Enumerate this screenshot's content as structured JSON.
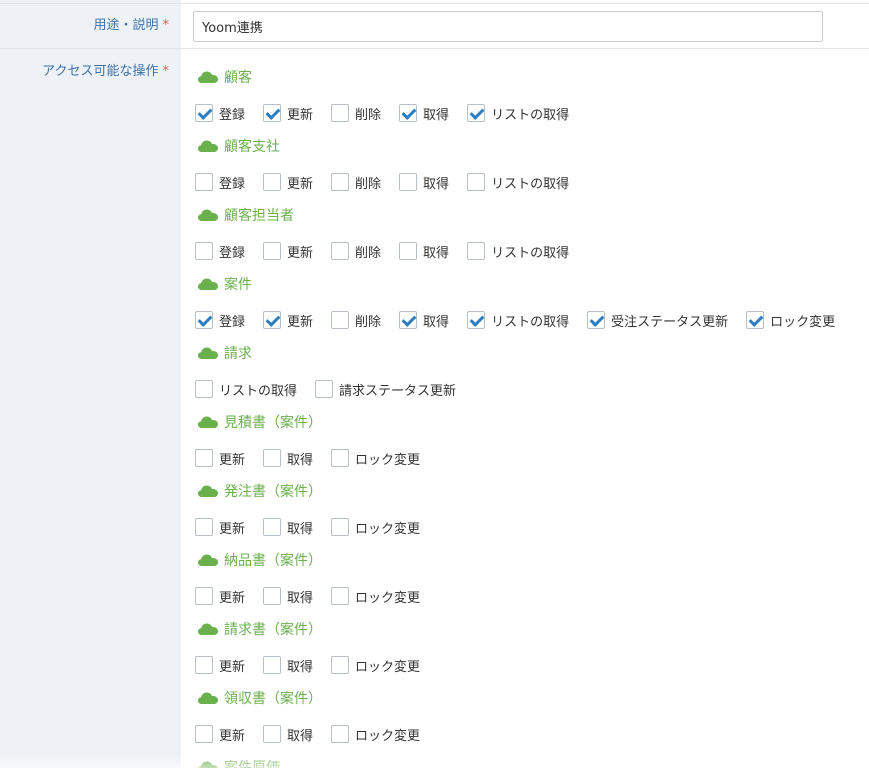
{
  "fields": {
    "purpose": {
      "label": "用途・説明",
      "required_mark": "*",
      "value": "Yoom連携"
    },
    "access": {
      "label": "アクセス可能な操作",
      "required_mark": "*"
    }
  },
  "groups": [
    {
      "title": "顧客",
      "options": [
        {
          "label": "登録",
          "checked": true
        },
        {
          "label": "更新",
          "checked": true
        },
        {
          "label": "削除",
          "checked": false
        },
        {
          "label": "取得",
          "checked": true
        },
        {
          "label": "リストの取得",
          "checked": true
        }
      ]
    },
    {
      "title": "顧客支社",
      "options": [
        {
          "label": "登録",
          "checked": false
        },
        {
          "label": "更新",
          "checked": false
        },
        {
          "label": "削除",
          "checked": false
        },
        {
          "label": "取得",
          "checked": false
        },
        {
          "label": "リストの取得",
          "checked": false
        }
      ]
    },
    {
      "title": "顧客担当者",
      "options": [
        {
          "label": "登録",
          "checked": false
        },
        {
          "label": "更新",
          "checked": false
        },
        {
          "label": "削除",
          "checked": false
        },
        {
          "label": "取得",
          "checked": false
        },
        {
          "label": "リストの取得",
          "checked": false
        }
      ]
    },
    {
      "title": "案件",
      "options": [
        {
          "label": "登録",
          "checked": true
        },
        {
          "label": "更新",
          "checked": true
        },
        {
          "label": "削除",
          "checked": false
        },
        {
          "label": "取得",
          "checked": true
        },
        {
          "label": "リストの取得",
          "checked": true
        },
        {
          "label": "受注ステータス更新",
          "checked": true
        },
        {
          "label": "ロック変更",
          "checked": true
        }
      ]
    },
    {
      "title": "請求",
      "options": [
        {
          "label": "リストの取得",
          "checked": false
        },
        {
          "label": "請求ステータス更新",
          "checked": false
        }
      ]
    },
    {
      "title": "見積書（案件）",
      "options": [
        {
          "label": "更新",
          "checked": false
        },
        {
          "label": "取得",
          "checked": false
        },
        {
          "label": "ロック変更",
          "checked": false
        }
      ]
    },
    {
      "title": "発注書（案件）",
      "options": [
        {
          "label": "更新",
          "checked": false
        },
        {
          "label": "取得",
          "checked": false
        },
        {
          "label": "ロック変更",
          "checked": false
        }
      ]
    },
    {
      "title": "納品書（案件）",
      "options": [
        {
          "label": "更新",
          "checked": false
        },
        {
          "label": "取得",
          "checked": false
        },
        {
          "label": "ロック変更",
          "checked": false
        }
      ]
    },
    {
      "title": "請求書（案件）",
      "options": [
        {
          "label": "更新",
          "checked": false
        },
        {
          "label": "取得",
          "checked": false
        },
        {
          "label": "ロック変更",
          "checked": false
        }
      ]
    },
    {
      "title": "領収書（案件）",
      "options": [
        {
          "label": "更新",
          "checked": false
        },
        {
          "label": "取得",
          "checked": false
        },
        {
          "label": "ロック変更",
          "checked": false
        }
      ]
    },
    {
      "title": "案件原価",
      "options": []
    }
  ],
  "icons": {
    "group": "cloud-icon"
  },
  "colors": {
    "label": "#3b73a9",
    "required": "#e05a4e",
    "group_title": "#6ab04c",
    "check": "#2d7ec1",
    "label_bg": "#eef1f5"
  }
}
